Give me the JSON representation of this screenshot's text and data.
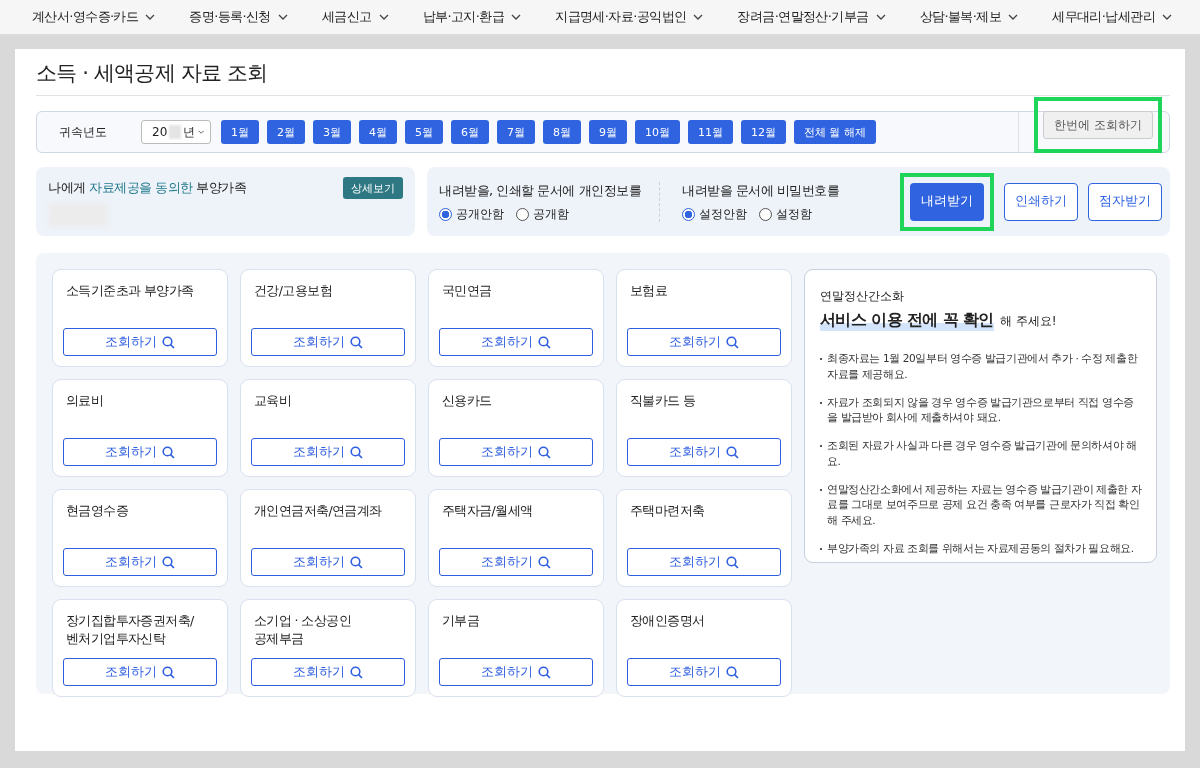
{
  "nav": [
    {
      "label": "계산서·영수증·카드"
    },
    {
      "label": "증명·등록·신청"
    },
    {
      "label": "세금신고"
    },
    {
      "label": "납부·고지·환급"
    },
    {
      "label": "지급명세·자료·공익법인"
    },
    {
      "label": "장려금·연말정산·기부금"
    },
    {
      "label": "상담·불복·제보"
    },
    {
      "label": "세무대리·납세관리"
    }
  ],
  "page_title": "소득 · 세액공제 자료 조회",
  "filter": {
    "label": "귀속년도",
    "year": "20",
    "year_suffix": "년",
    "months": [
      "1월",
      "2월",
      "3월",
      "4월",
      "5월",
      "6월",
      "7월",
      "8월",
      "9월",
      "10월",
      "11월",
      "12월"
    ],
    "clear_button": "전체 월 해제",
    "query_all_button": {
      "label": "한번에 조회하기",
      "highlighted": true
    }
  },
  "dependents": {
    "title": "나에게 **자료제공을 동의한** 부양가족",
    "detail_button": "상세보기"
  },
  "options": [
    {
      "title": "내려받을, 인쇄할 문서에 개인정보를",
      "radios": [
        {
          "label": "공개안함",
          "selected": true
        },
        {
          "label": "공개함",
          "selected": false
        }
      ]
    },
    {
      "title": "내려받을 문서에 비밀번호를",
      "radios": [
        {
          "label": "설정안함",
          "selected": true
        },
        {
          "label": "설정함",
          "selected": false
        }
      ]
    }
  ],
  "actions": [
    {
      "label": "내려받기",
      "kind": "primary",
      "highlighted": true
    },
    {
      "label": "인쇄하기",
      "kind": "outline",
      "highlighted": false
    },
    {
      "label": "점자받기",
      "kind": "outline",
      "highlighted": false
    }
  ],
  "categories": [
    {
      "title": "소득기준초과 부양가족",
      "button": "조회하기"
    },
    {
      "title": "건강/고용보험",
      "button": "조회하기"
    },
    {
      "title": "국민연금",
      "button": "조회하기"
    },
    {
      "title": "보험료",
      "button": "조회하기"
    },
    {
      "title": "의료비",
      "button": "조회하기"
    },
    {
      "title": "교육비",
      "button": "조회하기"
    },
    {
      "title": "신용카드",
      "button": "조회하기"
    },
    {
      "title": "직불카드 등",
      "button": "조회하기"
    },
    {
      "title": "현금영수증",
      "button": "조회하기"
    },
    {
      "title": "개인연금저축/연금계좌",
      "button": "조회하기"
    },
    {
      "title": "주택자금/월세액",
      "button": "조회하기"
    },
    {
      "title": "주택마련저축",
      "button": "조회하기"
    },
    {
      "title": "장기집합투자증권저축/\n벤처기업투자신탁",
      "button": "조회하기"
    },
    {
      "title": "소기업 · 소상공인\n공제부금",
      "button": "조회하기"
    },
    {
      "title": "기부금",
      "button": "조회하기"
    },
    {
      "title": "장애인증명서",
      "button": "조회하기"
    }
  ],
  "notice": {
    "subtitle": "연말정산간소화",
    "headline": "서비스 이용 전에 꼭 확인",
    "headline_suffix": "해 주세요!",
    "items": [
      "최종자료는 1월 20일부터 영수증 발급기관에서 추가 · 수정 제출한 자료를 제공해요.",
      "자료가 조회되지 않을 경우 영수증 발급기관으로부터 직접 영수증을 발급받아 회사에 제출하셔야 돼요.",
      "조회된 자료가 사실과 다른 경우 영수증 발급기관에 문의하셔야 해요.",
      "연말정산간소화에서 제공하는 자료는 영수증 발급기관이 제출한 자료를 그대로 보여주므로 공제 요건 충족 여부를 근로자가 직접 확인해 주세요.",
      "부양가족의 자료 조회를 위해서는 자료제공동의 절차가 필요해요."
    ]
  }
}
